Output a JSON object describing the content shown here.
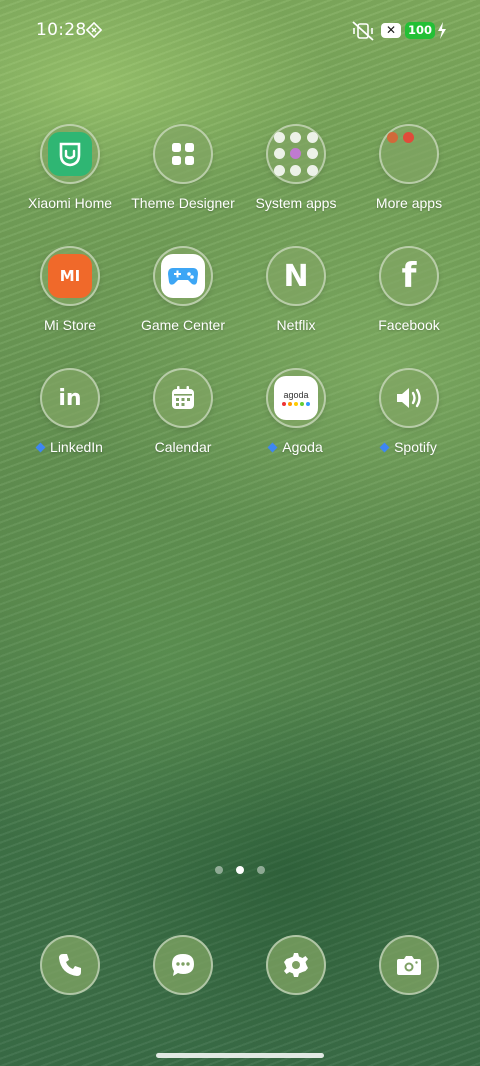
{
  "status_bar": {
    "time": "10:28",
    "x_badge": "✕",
    "battery": "100",
    "battery_color": "#23c035"
  },
  "apps": [
    {
      "label": "Xiaomi Home",
      "icon": "xiaomi-home-icon",
      "new": false
    },
    {
      "label": "Theme Designer",
      "icon": "theme-designer-icon",
      "new": false
    },
    {
      "label": "System apps",
      "icon": "system-apps-folder-icon",
      "new": false
    },
    {
      "label": "More apps",
      "icon": "more-apps-folder-icon",
      "new": false
    },
    {
      "label": "Mi Store",
      "icon": "mi-store-icon",
      "new": false,
      "glyph": "MI"
    },
    {
      "label": "Game Center",
      "icon": "game-center-icon",
      "new": false
    },
    {
      "label": "Netflix",
      "icon": "netflix-icon",
      "new": false,
      "glyph": "N"
    },
    {
      "label": "Facebook",
      "icon": "facebook-icon",
      "new": false,
      "glyph": "f"
    },
    {
      "label": "LinkedIn",
      "icon": "linkedin-icon",
      "new": true,
      "glyph": "in"
    },
    {
      "label": "Calendar",
      "icon": "calendar-icon",
      "new": false
    },
    {
      "label": "Agoda",
      "icon": "agoda-icon",
      "new": true,
      "glyph": "agoda"
    },
    {
      "label": "Spotify",
      "icon": "spotify-icon",
      "new": true
    }
  ],
  "page_indicator": {
    "count": 3,
    "active": 2
  },
  "dock": [
    {
      "icon": "phone-icon"
    },
    {
      "icon": "messages-icon"
    },
    {
      "icon": "settings-icon"
    },
    {
      "icon": "camera-icon"
    }
  ],
  "colors": {
    "new_dot": "#3e86f2",
    "mi_store": "#f0692a",
    "xiaomi_home": "#2fb673"
  }
}
